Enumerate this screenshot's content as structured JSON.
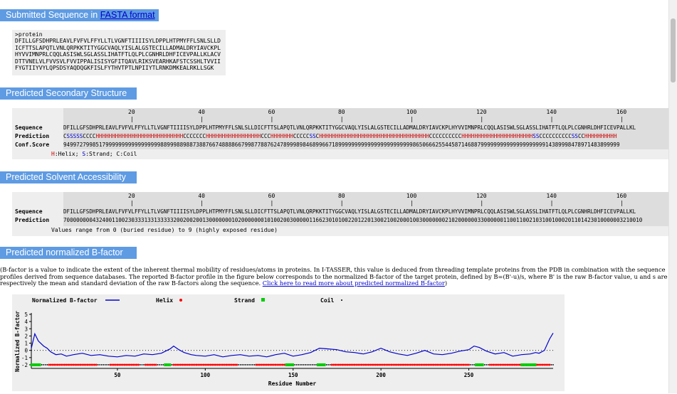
{
  "sections": {
    "fasta_title_prefix": "Submitted Sequence in ",
    "fasta_link": "FASTA format",
    "ss_title": "Predicted Secondary Structure",
    "sa_title": "Predicted Solvent Accessibility",
    "bf_title": "Predicted normalized B-factor"
  },
  "fasta": {
    "header": ">protein",
    "lines": [
      "DFILLGFSDHPRLEAVLFVFVLFFYLLTLVGNFTIIIISYLDPPLHTPMYFFLSNLSLLD",
      "ICFTTSLAPQTLVNLQRPKKTITYGGCVAQLYISLALGSTECILLADMALDRYIAVCKPL",
      "HYVVIMNPRLCQQLASISWLSGLASSLIHATFTLQLPLCGNHRLDHFICEVPALLKLACV",
      "DTTVNELVLFVVSVLFVVIPPALISISYGFITQAVLRIKSVEARHKAFSTCSSHLTVVII",
      "FYGTIIYVYLQPSDSYAQDQGKFISLFYTHVTPTLNPIIYTLRNKDMKEALRKLLSGK"
    ]
  },
  "ruler": {
    "ticks": [
      "20",
      "40",
      "60",
      "80",
      "100",
      "120",
      "140",
      "160"
    ]
  },
  "ss": {
    "sequence_label": "Sequence",
    "prediction_label": "Prediction",
    "conf_label": "Conf.Score",
    "sequence": "DFILLGFSDHPRLEAVLFVFVLFFYLLTLVGNFTIIIISYLDPPLHTPMYFFLSNLSLLDICFTTSLAPQTLVNLQRPKKTITYGGCVAQLYISLALGSTECILLADMALDRYIAVCKPLHYVVIMNPRLCQQLASISWLSGLASSLIHATFTLQLPLCGNHRLDHFICEVPALLKL",
    "prediction": "CSSSSSCCCCHHHHHHHHHHHHHHHHHHHHHHHHHHHCCCCCCCHHHHHHHHHHHHHHHHHCCCHHHHHHHCCCCCSSCHHHHHHHHHHHHHHHHHHHHHHHHHHHHHHHHHHCCCCCCCCCCHHHHHHHHHHHHHHHHHHHHHHSSCCCCCCCCCCSSCCHHHHHHHHHH",
    "conf": "9499727998517999999999999999998899988988738876674888866799877887624789998984689966718999999999999999999999998650666255445871468879999999999999999999914389998478971483899999",
    "legend": [
      {
        "letter": "H",
        "text": ":Helix; "
      },
      {
        "letter": "S",
        "text": ":Strand; "
      },
      {
        "letter": "C",
        "text": ":Coil"
      }
    ]
  },
  "sa": {
    "sequence_label": "Sequence",
    "prediction_label": "Prediction",
    "sequence": "DFILLGFSDHPRLEAVLFVFVLFFYLLTLVGNFTIIIISYLDPPLHTPMYFFLSNLSLLDICFTTSLAPQTLVNLQRPKKTITYGGCVAQLYISLALGSTECILLADMALDRYIAVCKPLHYVVIMNPRLCQQLASISWLSGLASSLIHATFTLQLPLCGNHRLDHFICEVPALLKL",
    "prediction": "70000000043240011002303331331333332002002001300000001020000000101002003000001166230101002201220130021002000100300000002102000000330000001100110021031001000201101423010000003210010",
    "note": "Values range from 0 (buried residue) to 9 (highly exposed residue)"
  },
  "bfactor": {
    "paragraph": "(B-factor is a value to indicate the extent of the inherent thermal mobility of residues/atoms in proteins. In I-TASSER, this value is deduced from threading template proteins from the PDB in combination with the sequence profiles derived from sequence databases. The reported B-factor profile in the figure below corresponds to the normalized B-factor of the target protein, defined by B=(B'-u)/s, where B' is the raw B-factor value, u and s are respectively the mean and standard deviation of the raw B-factors along the sequence. ",
    "link_text": "Click here to read more about predicted normalized B-factor",
    "paragraph_end": ")"
  },
  "chart_data": {
    "type": "line",
    "xlabel": "Residue Number",
    "ylabel": "Normalized B-factor",
    "xticks": [
      50,
      100,
      150,
      200,
      250
    ],
    "yticks": [
      5,
      4,
      3,
      2,
      1,
      0,
      -1,
      -2
    ],
    "xlim": [
      1,
      298
    ],
    "ylim": [
      -2.5,
      5
    ],
    "legend": [
      {
        "name": "Normalized B-factor",
        "color": "#0000cc",
        "marker": "line"
      },
      {
        "name": "Helix",
        "color": "#ff0000",
        "marker": "dot"
      },
      {
        "name": "Strand",
        "color": "#00cc00",
        "marker": "square"
      },
      {
        "name": "Coil",
        "color": "#000000",
        "marker": "dot"
      }
    ],
    "series": [
      {
        "name": "Normalized B-factor",
        "x": [
          1,
          3,
          5,
          8,
          10,
          12,
          15,
          18,
          21,
          25,
          30,
          35,
          40,
          45,
          50,
          55,
          60,
          65,
          70,
          75,
          80,
          82,
          85,
          88,
          92,
          95,
          100,
          105,
          110,
          115,
          120,
          125,
          130,
          135,
          140,
          145,
          150,
          155,
          160,
          165,
          170,
          175,
          180,
          185,
          190,
          195,
          200,
          205,
          210,
          215,
          220,
          225,
          230,
          235,
          240,
          245,
          250,
          253,
          256,
          260,
          265,
          270,
          275,
          280,
          285,
          288,
          290,
          293,
          296,
          298
        ],
        "values": [
          0.3,
          2.3,
          1.3,
          0.6,
          0.3,
          -0.2,
          -0.6,
          -0.5,
          -0.8,
          -0.6,
          -0.4,
          -0.7,
          -0.6,
          -0.8,
          -0.9,
          -0.7,
          -0.8,
          -0.5,
          -0.6,
          -0.4,
          0.2,
          0.6,
          0.1,
          -0.3,
          -0.6,
          -0.7,
          -0.8,
          -0.6,
          -0.9,
          -0.7,
          -0.6,
          -0.8,
          -0.7,
          -0.9,
          -0.6,
          -0.4,
          -0.8,
          -0.6,
          -0.3,
          0.3,
          0.2,
          0.1,
          -0.2,
          -0.3,
          -0.5,
          -0.2,
          0.3,
          -0.2,
          -0.5,
          -0.7,
          -0.4,
          0.0,
          -0.5,
          -0.6,
          -0.4,
          -0.1,
          0.1,
          0.6,
          0.4,
          -0.1,
          -0.5,
          -0.3,
          -0.8,
          -0.6,
          -0.5,
          -0.3,
          -0.4,
          0.0,
          1.6,
          2.4
        ]
      }
    ],
    "strand_ranges": [
      [
        1,
        6
      ],
      [
        77,
        80
      ],
      [
        146,
        150
      ],
      [
        164,
        168
      ],
      [
        254,
        258
      ],
      [
        280,
        288
      ]
    ],
    "helix_ranges": [
      [
        11,
        38
      ],
      [
        46,
        62
      ],
      [
        66,
        72
      ],
      [
        82,
        118
      ],
      [
        129,
        150
      ],
      [
        172,
        250
      ],
      [
        262,
        296
      ]
    ]
  },
  "colors": {
    "header_bg": "#5e9be3",
    "panel_bg": "#eeeeee",
    "helix": "#cc0000",
    "strand": "#0000cc",
    "curve": "#0000cc"
  }
}
